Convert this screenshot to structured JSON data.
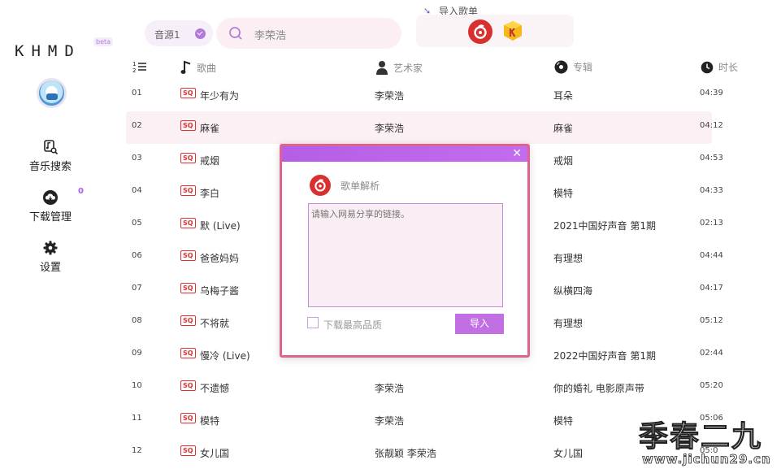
{
  "app": {
    "logo": "KHMD",
    "beta": "beta"
  },
  "sidebar": {
    "items": [
      {
        "label": "音乐搜索",
        "icon": "music-search-icon"
      },
      {
        "label": "下载管理",
        "icon": "cloud-download-icon",
        "badge": "0"
      },
      {
        "label": "设置",
        "icon": "gear-icon"
      }
    ]
  },
  "topbar": {
    "source": "音源1",
    "search_value": "李荣浩",
    "import_label": "导入歌单"
  },
  "table": {
    "headers": {
      "title": "歌曲",
      "artist": "艺术家",
      "album": "专辑",
      "duration": "时长"
    },
    "quality_badge": "SQ",
    "rows": [
      {
        "index": "01",
        "title": "年少有为",
        "artist": "李荣浩",
        "album": "耳朵",
        "duration": "04:39"
      },
      {
        "index": "02",
        "title": "麻雀",
        "artist": "李荣浩",
        "album": "麻雀",
        "duration": "04:12"
      },
      {
        "index": "03",
        "title": "戒烟",
        "artist": "",
        "album": "戒烟",
        "duration": "04:53"
      },
      {
        "index": "04",
        "title": "李白",
        "artist": "",
        "album": "模特",
        "duration": "04:33"
      },
      {
        "index": "05",
        "title": "默 (Live)",
        "artist": "",
        "album": "2021中国好声音 第1期",
        "duration": "02:13"
      },
      {
        "index": "06",
        "title": "爸爸妈妈",
        "artist": "",
        "album": "有理想",
        "duration": "04:44"
      },
      {
        "index": "07",
        "title": "乌梅子酱",
        "artist": "",
        "album": "纵横四海",
        "duration": "04:17"
      },
      {
        "index": "08",
        "title": "不将就",
        "artist": "",
        "album": "有理想",
        "duration": "05:12"
      },
      {
        "index": "09",
        "title": "慢冷 (Live)",
        "artist": "",
        "album": "2022中国好声音 第1期",
        "duration": "02:44"
      },
      {
        "index": "10",
        "title": "不遗憾",
        "artist": "李荣浩",
        "album": "你的婚礼 电影原声带",
        "duration": "05:20"
      },
      {
        "index": "11",
        "title": "模特",
        "artist": "李荣浩",
        "album": "模特",
        "duration": "05:06"
      },
      {
        "index": "12",
        "title": "女儿国",
        "artist": "张靓颖 李荣浩",
        "album": "女儿国",
        "duration": "05:0"
      }
    ]
  },
  "dialog": {
    "title": "歌单解析",
    "placeholder": "请输入网易分享的链接。",
    "checkbox_label": "下载最高品质",
    "import_button": "导入"
  },
  "watermark": {
    "text": "季春二九",
    "url": "www.jichun29.cn"
  },
  "colors": {
    "accent": "#c16fe3",
    "dialog_border": "#e2628e",
    "highlight_row": "#fbf0f4",
    "netease_red": "#d82f2f"
  }
}
